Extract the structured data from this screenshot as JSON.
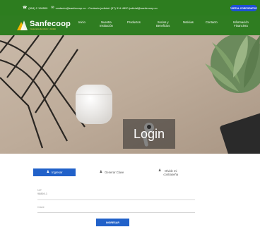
{
  "topbar": {
    "phone": "(604) 2 196500",
    "email": "contacto@sanfecoop.co - Contacto judicial: (57) 314 4820 judicial@sanfecoop.co",
    "corporate_button": "PORTAL CORPORATIVO"
  },
  "brand": {
    "name": "Sanfecoop",
    "tagline": "Cooperativa de Ahorro y Crédito"
  },
  "nav": {
    "items": [
      {
        "line1": "Inicio",
        "line2": ""
      },
      {
        "line1": "Nuestra",
        "line2": "Institución"
      },
      {
        "line1": "Productos",
        "line2": ""
      },
      {
        "line1": "Socios y",
        "line2": "Beneficios"
      },
      {
        "line1": "Noticias",
        "line2": ""
      },
      {
        "line1": "Contacto",
        "line2": ""
      },
      {
        "line1": "Información",
        "line2": "Financiera"
      }
    ]
  },
  "hero": {
    "title": "Login"
  },
  "tabs": {
    "ingresar": "Ingresar",
    "generar": "Generar Clave",
    "olvide_line1": "Olvide mi",
    "olvide_line2": "contraseña"
  },
  "form": {
    "user_label": "NIT",
    "user_value": "98869-1",
    "password_placeholder": "Clave",
    "submit_label": "INGRESAR"
  },
  "colors": {
    "brand_green": "#2f7d21",
    "accent_blue": "#2161c9",
    "logo_gold": "#f0b400"
  }
}
